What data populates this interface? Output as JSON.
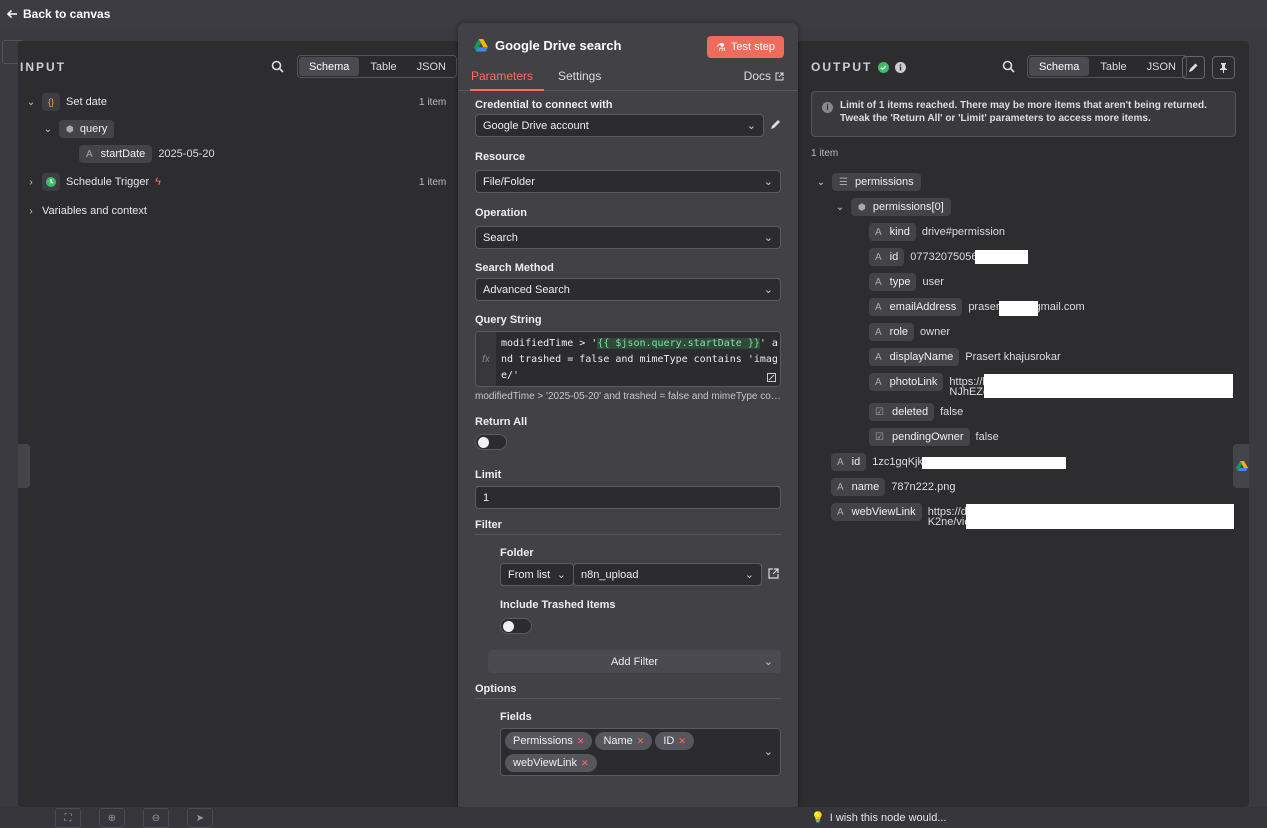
{
  "topbar": {
    "back_label": "Back to canvas"
  },
  "input": {
    "title": "INPUT",
    "views": [
      "Schema",
      "Table",
      "JSON"
    ],
    "tree": {
      "set_date": {
        "label": "Set date",
        "count": "1 item"
      },
      "query": {
        "label": "query"
      },
      "start_date": {
        "key": "startDate",
        "value": "2025-05-20"
      },
      "schedule": {
        "label": "Schedule Trigger",
        "count": "1 item"
      },
      "variables": {
        "label": "Variables and context"
      }
    }
  },
  "node": {
    "title": "Google Drive search",
    "test_label": "Test step",
    "tabs": {
      "parameters": "Parameters",
      "settings": "Settings",
      "docs": "Docs"
    },
    "credential": {
      "label": "Credential to connect with",
      "value": "Google Drive account"
    },
    "resource": {
      "label": "Resource",
      "value": "File/Folder"
    },
    "operation": {
      "label": "Operation",
      "value": "Search"
    },
    "search_method": {
      "label": "Search Method",
      "value": "Advanced Search"
    },
    "query_string": {
      "label": "Query String",
      "pre": "modifiedTime > '",
      "expr": "{{ $json.query.startDate }}",
      "post": "' and trashed = false and mimeType contains 'image/'",
      "preview": "modifiedTime > '2025-05-20' and trashed = false and mimeType contains 'image/'"
    },
    "return_all": {
      "label": "Return All"
    },
    "limit": {
      "label": "Limit",
      "value": "1"
    },
    "filter": {
      "label": "Filter",
      "folder_label": "Folder",
      "folder_mode": "From list",
      "folder_value": "n8n_upload",
      "trashed_label": "Include Trashed Items",
      "add_filter": "Add Filter"
    },
    "options": {
      "label": "Options",
      "fields_label": "Fields",
      "fields": [
        "Permissions",
        "Name",
        "ID",
        "webViewLink"
      ]
    }
  },
  "output": {
    "title": "OUTPUT",
    "views": [
      "Schema",
      "Table",
      "JSON"
    ],
    "notice": "Limit of 1 items reached. There may be more items that aren't being returned. Tweak the 'Return All' or 'Limit' parameters to access more items.",
    "count": "1 item",
    "permissions": "permissions",
    "permissions0": "permissions[0]",
    "rows": [
      {
        "k": "kind",
        "v": "drive#permission"
      },
      {
        "k": "id",
        "v": "07732075056"
      },
      {
        "k": "type",
        "v": "user"
      },
      {
        "k": "emailAddress",
        "v": "praserti kar@gmail.com"
      },
      {
        "k": "role",
        "v": "owner"
      },
      {
        "k": "displayName",
        "v": "Prasert khajusrokar"
      },
      {
        "k": "photoLink",
        "v": "https://l"
      },
      {
        "k": "photoLink2",
        "v": "NJhEZc"
      },
      {
        "k": "deleted",
        "v": "false"
      },
      {
        "k": "pendingOwner",
        "v": "false"
      }
    ],
    "file_id": {
      "k": "id",
      "v": "1zc1gqKjkE"
    },
    "file_name": {
      "k": "name",
      "v": "787n222.png"
    },
    "web_view": {
      "k": "webViewLink",
      "v": "https://d",
      "v2": "K2ne/vie"
    }
  },
  "footer": {
    "wish": "I wish this node would..."
  },
  "colors": {
    "accent": "#ff6d5a",
    "success": "#3dbd6b",
    "test": "#ef6b5b"
  }
}
